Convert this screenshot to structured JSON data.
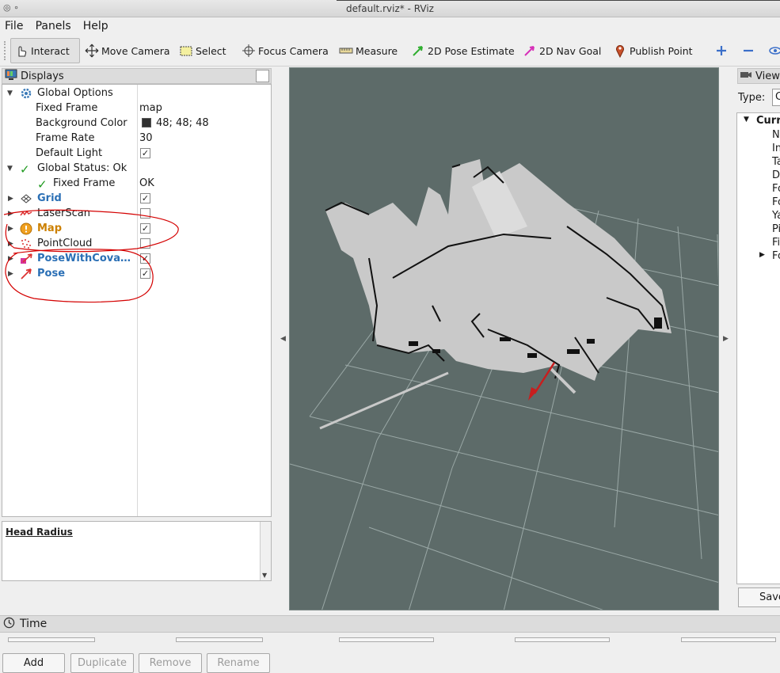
{
  "window": {
    "title": "default.rviz* - RViz"
  },
  "menu": [
    {
      "label": "File"
    },
    {
      "label": "Panels"
    },
    {
      "label": "Help"
    }
  ],
  "toolbar": {
    "interact": "Interact",
    "move_camera": "Move Camera",
    "select": "Select",
    "focus_camera": "Focus Camera",
    "measure": "Measure",
    "pose_estimate": "2D Pose Estimate",
    "nav_goal": "2D Nav Goal",
    "publish_point": "Publish Point"
  },
  "displays": {
    "title": "Displays",
    "global_options": "Global Options",
    "fixed_frame_label": "Fixed Frame",
    "fixed_frame_value": "map",
    "background_color_label": "Background Color",
    "background_color_value": "48; 48; 48",
    "frame_rate_label": "Frame Rate",
    "frame_rate_value": "30",
    "default_light_label": "Default Light",
    "global_status": "Global Status: Ok",
    "status_fixed_frame_label": "Fixed Frame",
    "status_fixed_frame_value": "OK",
    "items": [
      {
        "label": "Grid",
        "checked": true
      },
      {
        "label": "LaserScan",
        "checked": false
      },
      {
        "label": "Map",
        "checked": true
      },
      {
        "label": "PointCloud",
        "checked": false
      },
      {
        "label": "PoseWithCova…",
        "checked": true
      },
      {
        "label": "Pose",
        "checked": true
      }
    ],
    "help_title": "Head Radius",
    "buttons": {
      "add": "Add",
      "duplicate": "Duplicate",
      "remove": "Remove",
      "rename": "Rename"
    }
  },
  "views": {
    "title": "Views",
    "type_label": "Type:",
    "type_value": "C",
    "tree": [
      "Curr",
      "Ne",
      "In",
      "Ta",
      "D",
      "Fo",
      "Fo",
      "Ya",
      "Pi",
      "Fi",
      "Fo"
    ],
    "save": "Save"
  },
  "time": {
    "title": "Time"
  },
  "colors": {
    "viewport_bg": "#5d6b69",
    "map_free": "#c9c9c9",
    "annotation": "#d40000",
    "blue_label": "#2a6fb5",
    "orange_label": "#cc8000"
  }
}
